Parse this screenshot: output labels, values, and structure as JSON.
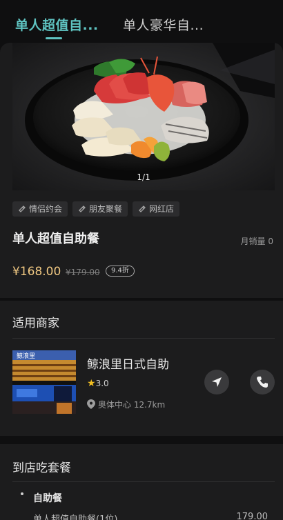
{
  "tabs": [
    {
      "label": "单人超值自..."
    },
    {
      "label": "单人豪华自..."
    }
  ],
  "product": {
    "pager": "1/1",
    "tags": [
      "情侣约会",
      "朋友聚餐",
      "网红店"
    ],
    "title": "单人超值自助餐",
    "monthly_sales": "月销量 0",
    "price": "¥168.00",
    "original_price": "¥179.00",
    "discount": "9.4折"
  },
  "merchants": {
    "section_title": "适用商家",
    "store": {
      "sign_text": "鲸浪里",
      "name": "鲸浪里日式自助",
      "rating": "3.0",
      "location": "奥体中心 12.7km"
    }
  },
  "dine_in": {
    "section_title": "到店吃套餐",
    "group": "自助餐",
    "item_name": "单人超值自助餐(1位)",
    "item_price": "179.00"
  },
  "colors": {
    "accent": "#5fc4c2",
    "price": "#f0c882",
    "background": "#0f0f10",
    "card": "#1c1c1d"
  }
}
